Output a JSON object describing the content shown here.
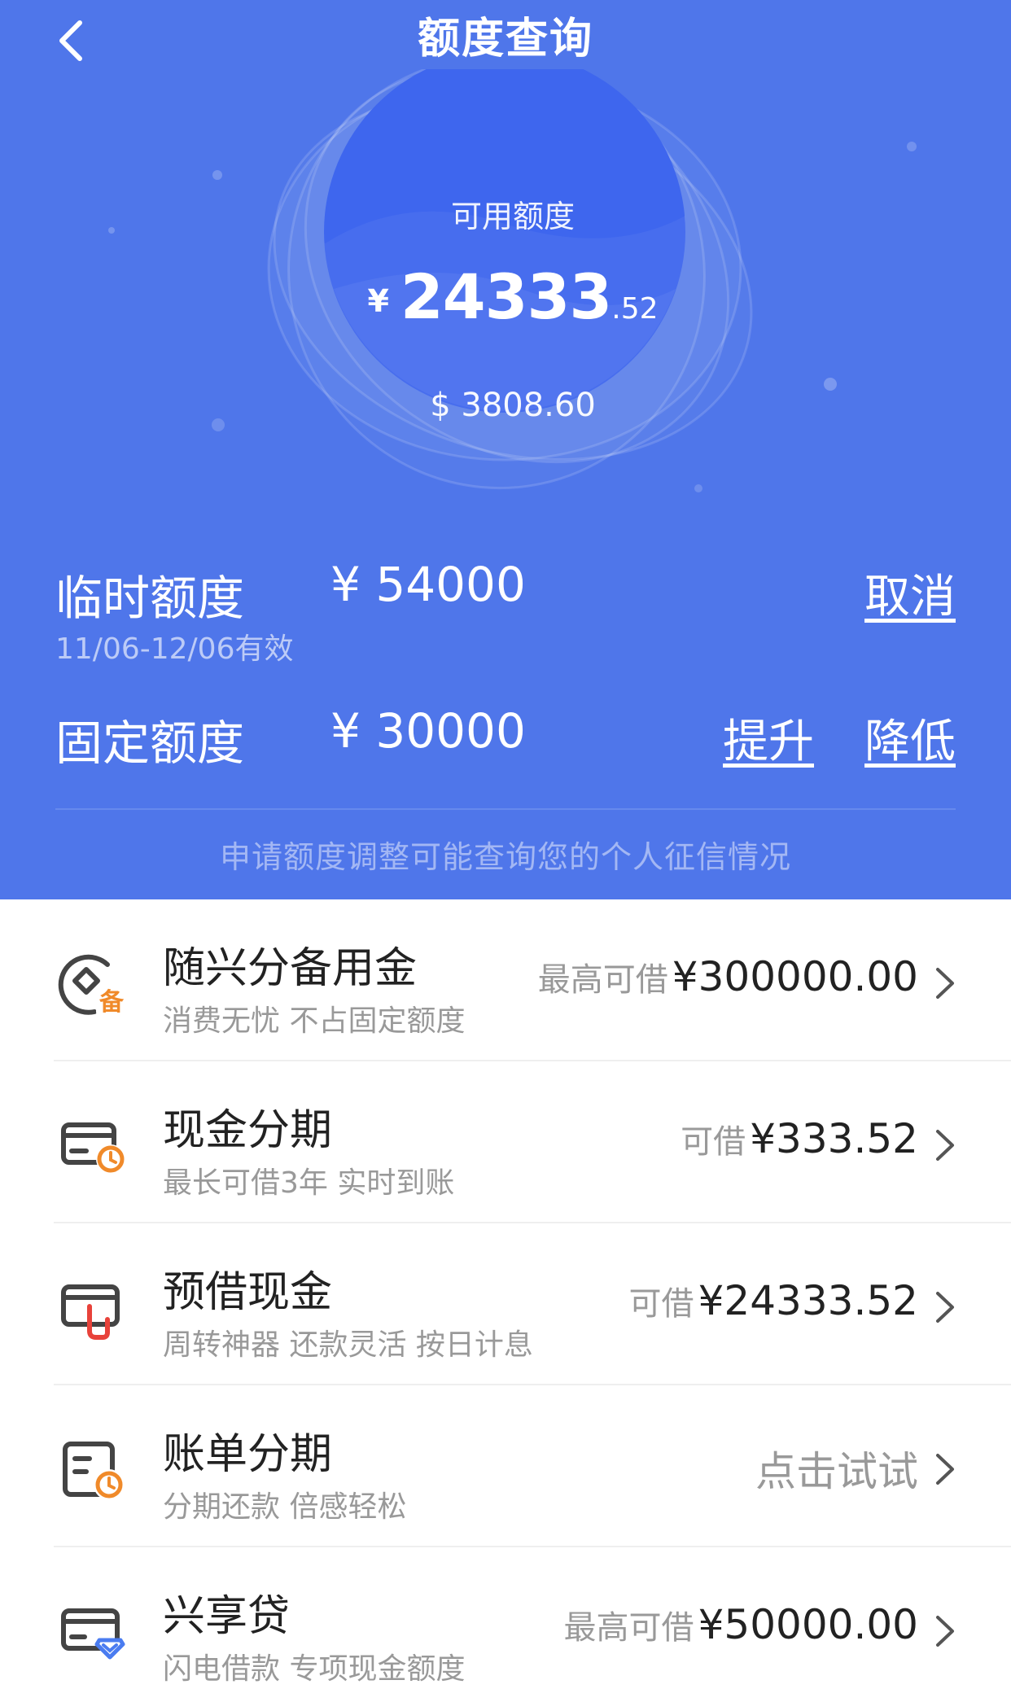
{
  "header": {
    "title": "额度查询"
  },
  "orb": {
    "label": "可用额度",
    "currency": "¥",
    "amount_int": "24333",
    "amount_dec": ".52",
    "usd": "$ 3808.60"
  },
  "temp_quota": {
    "label": "临时额度",
    "value": "¥ 54000",
    "validity": "11/06-12/06有效",
    "cancel_label": "取消"
  },
  "fixed_quota": {
    "label": "固定额度",
    "value": "¥ 30000",
    "raise_label": "提升",
    "lower_label": "降低"
  },
  "notice": "申请额度调整可能查询您的个人征信情况",
  "list": [
    {
      "title": "随兴分备用金",
      "sub": "消费无忧 不占固定额度",
      "pre": "最高可借",
      "amount": "¥300000.00",
      "icon": "backup-fund-icon"
    },
    {
      "title": "现金分期",
      "sub": "最长可借3年 实时到账",
      "pre": "可借",
      "amount": "¥333.52",
      "icon": "cash-installment-icon"
    },
    {
      "title": "预借现金",
      "sub": "周转神器 还款灵活 按日计息",
      "pre": "可借",
      "amount": "¥24333.52",
      "icon": "cash-advance-icon"
    },
    {
      "title": "账单分期",
      "sub": "分期还款 倍感轻松",
      "try": "点击试试",
      "icon": "bill-installment-icon"
    },
    {
      "title": "兴享贷",
      "sub": "闪电借款 专项现金额度",
      "pre": "最高可借",
      "amount": "¥50000.00",
      "icon": "xing-loan-icon"
    }
  ],
  "colors": {
    "hero_bg": "#4f76ea",
    "orb": "#3e66ee",
    "accent_orange": "#f08a2a",
    "accent_red": "#e8423a",
    "accent_blue": "#4a7cf0"
  }
}
